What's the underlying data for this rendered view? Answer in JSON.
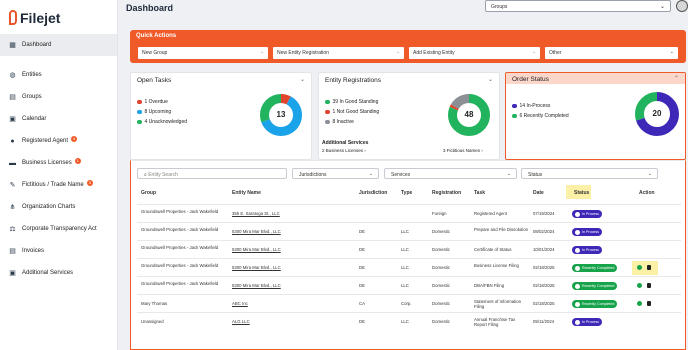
{
  "app": {
    "name": "Filejet",
    "accent": "#f05a28"
  },
  "sidebar": {
    "items": [
      {
        "label": "Dashboard",
        "icon": "grid-icon",
        "active": true
      },
      {
        "label": "Entities",
        "icon": "globe-icon"
      },
      {
        "label": "Groups",
        "icon": "folder-icon"
      },
      {
        "label": "Calendar",
        "icon": "calendar-icon"
      },
      {
        "label": "Registered Agent",
        "icon": "user-icon",
        "badge": "4"
      },
      {
        "label": "Business Licenses",
        "icon": "briefcase-icon",
        "badge": "1"
      },
      {
        "label": "Fictitious / Trade Name",
        "icon": "tag-icon",
        "badge": "3"
      },
      {
        "label": "Organization Charts",
        "icon": "org-chart-icon"
      },
      {
        "label": "Corporate Transparency Act",
        "icon": "transparency-icon"
      },
      {
        "label": "Invoices",
        "icon": "invoice-icon"
      },
      {
        "label": "Additional Services",
        "icon": "services-icon"
      }
    ]
  },
  "header": {
    "title": "Dashboard",
    "groups_select": "Groups"
  },
  "quick_actions": {
    "title": "Quick Actions",
    "buttons": [
      "New Group",
      "New Entity Registration",
      "Add Existing Entity",
      "Other"
    ]
  },
  "open_tasks": {
    "title": "Open Tasks",
    "total": "13",
    "legend": [
      {
        "label": "1 Overdue",
        "color": "#e0442b",
        "value": 1
      },
      {
        "label": "8 Upcoming",
        "color": "#1aa3e8",
        "value": 8
      },
      {
        "label": "4 Unacknowledged",
        "color": "#22b35e",
        "value": 4
      }
    ]
  },
  "entity_registrations": {
    "title": "Entity Registrations",
    "total": "48",
    "legend": [
      {
        "label": "39 In Good Standing",
        "color": "#22b35e",
        "value": 39
      },
      {
        "label": "1 Not Good Standing",
        "color": "#e0442b",
        "value": 1
      },
      {
        "label": "8 Inactive",
        "color": "#8b8f96",
        "value": 8
      }
    ],
    "additional_title": "Additional Services",
    "business_licenses": "2 Business Licenses",
    "fictitious_names": "3 Fictitious Names"
  },
  "order_status": {
    "title": "Order Status",
    "total": "20",
    "legend": [
      {
        "label": "14 In-Process",
        "color": "#3d28b8",
        "value": 14
      },
      {
        "label": "6 Recently Completed",
        "color": "#22b35e",
        "value": 6
      }
    ]
  },
  "filters": {
    "search_placeholder": "Entity Search",
    "jurisdictions": "Jurisdictions",
    "services": "Services",
    "status": "Status"
  },
  "table": {
    "headers": [
      "Group",
      "Entity Name",
      "Jurisdiction",
      "Type",
      "Registration",
      "Task",
      "Date",
      "Status",
      "Action"
    ],
    "rows": [
      {
        "group": "Groundswell Properties - Jack Wakefield",
        "entity": "355 E. Saratoga St., LLC",
        "jurisdiction": "",
        "type": "",
        "registration": "Foreign",
        "task": "Registered Agent",
        "date": "07/19/2024",
        "status": "In Process",
        "status_kind": "blue"
      },
      {
        "group": "Groundswell Properties - Jack Wakefield",
        "entity": "5300 Mira Mar Blvd., LLC",
        "jurisdiction": "DE",
        "type": "LLC",
        "registration": "Domestic",
        "task": "Prepare and File Dissolution",
        "date": "08/02/2024",
        "status": "In Process",
        "status_kind": "blue"
      },
      {
        "group": "Groundswell Properties - Jack Wakefield",
        "entity": "5300 Mira Mar Blvd., LLC",
        "jurisdiction": "DE",
        "type": "LLC",
        "registration": "Domestic",
        "task": "Certificate of Status",
        "date": "10/01/2024",
        "status": "In Process",
        "status_kind": "blue"
      },
      {
        "group": "Groundswell Properties - Jack Wakefield",
        "entity": "5300 Mira Mar Blvd., LLC",
        "jurisdiction": "DE",
        "type": "LLC",
        "registration": "Domestic",
        "task": "Business License Filing",
        "date": "02/18/2025",
        "status": "Recently Completed",
        "status_kind": "green",
        "actions": true,
        "highlight": true
      },
      {
        "group": "Groundswell Properties - Jack Wakefield",
        "entity": "5300 Mira Mar Blvd., LLC",
        "jurisdiction": "DE",
        "type": "LLC",
        "registration": "Domestic",
        "task": "DBA/FBN Filing",
        "date": "02/18/2025",
        "status": "Recently Completed",
        "status_kind": "green",
        "actions": true
      },
      {
        "group": "Mary Thomas",
        "entity": "ABC Inc",
        "jurisdiction": "CA",
        "type": "Corp.",
        "registration": "Domestic",
        "task": "Statement of Information Filing",
        "date": "02/18/2025",
        "status": "Recently Completed",
        "status_kind": "green",
        "actions": true
      },
      {
        "group": "Unassigned",
        "entity": "ALG LLC",
        "jurisdiction": "DE",
        "type": "LLC",
        "registration": "Domestic",
        "task": "Annual Franchise Tax Report Filing",
        "date": "09/11/2024",
        "status": "In Process",
        "status_kind": "blue"
      }
    ]
  }
}
